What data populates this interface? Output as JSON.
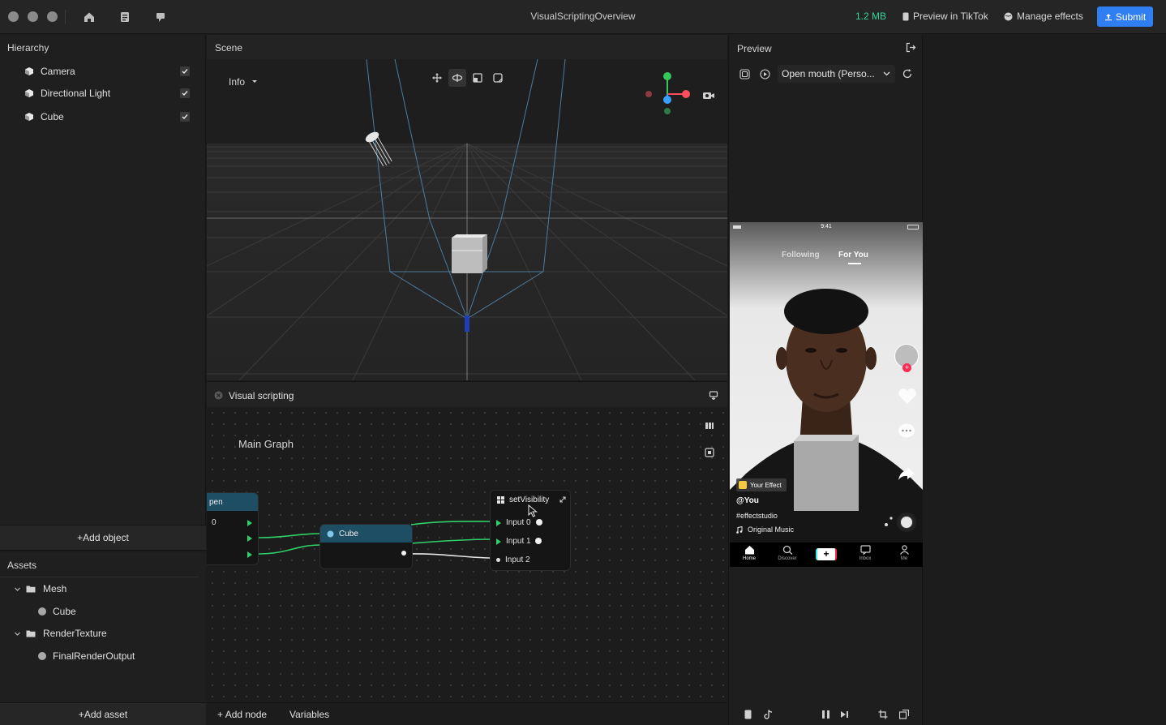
{
  "window": {
    "title": "VisualScriptingOverview",
    "project_size": "1.2 MB",
    "actions": {
      "preview_tiktok": "Preview in TikTok",
      "manage_effects": "Manage effects",
      "submit": "Submit"
    }
  },
  "hierarchy": {
    "title": "Hierarchy",
    "items": [
      {
        "label": "Camera",
        "visible": true
      },
      {
        "label": "Directional Light",
        "visible": true
      },
      {
        "label": "Cube",
        "visible": true
      }
    ],
    "add_label": "Add object"
  },
  "assets": {
    "title": "Assets",
    "groups": [
      {
        "label": "Mesh",
        "children": [
          "Cube"
        ]
      },
      {
        "label": "RenderTexture",
        "children": [
          "FinalRenderOutput"
        ]
      }
    ],
    "add_label": "Add asset"
  },
  "scene": {
    "title": "Scene",
    "view_mode": "Info"
  },
  "visual_scripting": {
    "title": "Visual scripting",
    "graph_name": "Main Graph",
    "nodes": {
      "left_node": {
        "title": "pen",
        "value": "0"
      },
      "cube_node": {
        "title": "Cube"
      },
      "set_visibility": {
        "title": "setVisibility",
        "inputs": [
          "Input 0",
          "Input 1",
          "Input 2"
        ]
      }
    },
    "footer": {
      "add_node": "Add node",
      "variables": "Variables"
    }
  },
  "preview": {
    "title": "Preview",
    "selected_option": "Open mouth (Perso...",
    "phone": {
      "time": "9:41",
      "tabs": [
        "Following",
        "For You"
      ],
      "active_tab": "For You",
      "effect_badge": "Your Effect",
      "username": "@You",
      "hashtag": "#effectstudio",
      "music": "Original Music",
      "nav": [
        "Home",
        "Discover",
        "",
        "Inbox",
        "Me"
      ]
    }
  },
  "colors": {
    "accent": "#2f7ff2",
    "size_green": "#36d39a",
    "port_green": "#2fd06a",
    "node_teal": "#1e4e63"
  }
}
